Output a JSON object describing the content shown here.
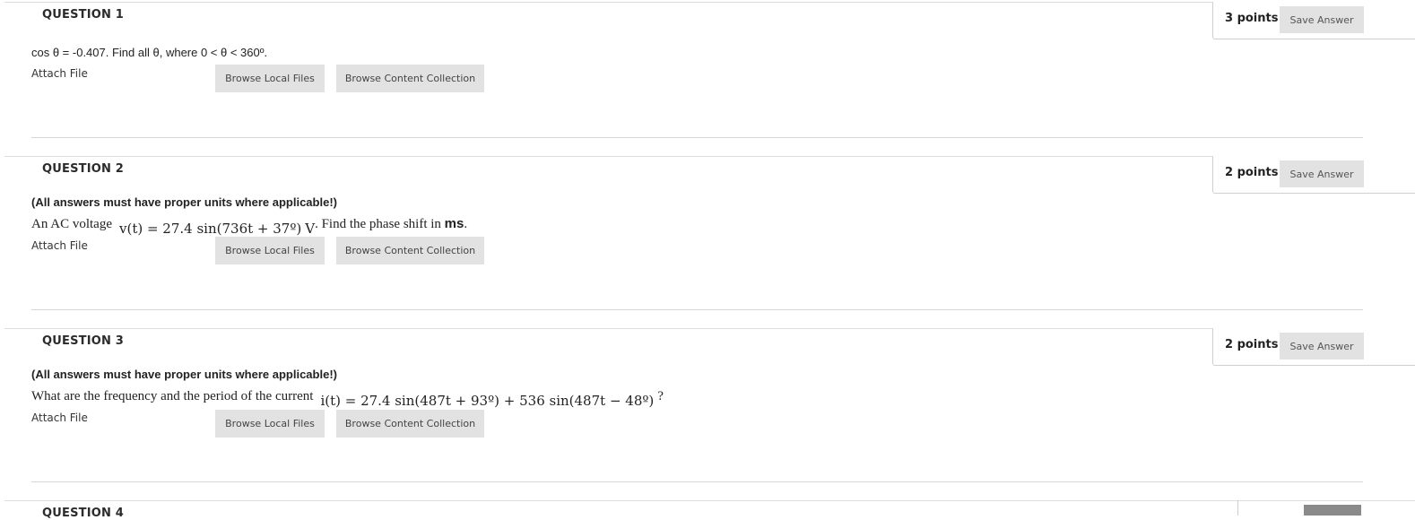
{
  "q1": {
    "title": "QUESTION 1",
    "points": "3 points",
    "save": "Save Answer",
    "text": "cos θ = -0.407. Find all θ, where 0 < θ < 360º.",
    "attach": "Attach File",
    "browse_local": "Browse Local Files",
    "browse_content": "Browse Content Collection"
  },
  "q2": {
    "title": "QUESTION 2",
    "points": "2 points",
    "save": "Save Answer",
    "note": "(All answers must have proper units where applicable!)",
    "text_a": "An AC voltage",
    "math": "v(t) = 27.4 sin(736t + 37º)",
    "text_v": "V",
    "text_b": ". Find the phase shift in ",
    "unit": "ms",
    "text_c": ".",
    "attach": "Attach File",
    "browse_local": "Browse Local Files",
    "browse_content": "Browse Content Collection"
  },
  "q3": {
    "title": "QUESTION 3",
    "points": "2 points",
    "save": "Save Answer",
    "note": "(All answers must have proper units where applicable!)",
    "text_a": "What are the frequency and the period of the current",
    "math": "i(t) = 27.4 sin(487t + 93º) + 536 sin(487t − 48º)",
    "text_b": "?",
    "attach": "Attach File",
    "browse_local": "Browse Local Files",
    "browse_content": "Browse Content Collection"
  },
  "q4": {
    "title": "QUESTION 4"
  }
}
